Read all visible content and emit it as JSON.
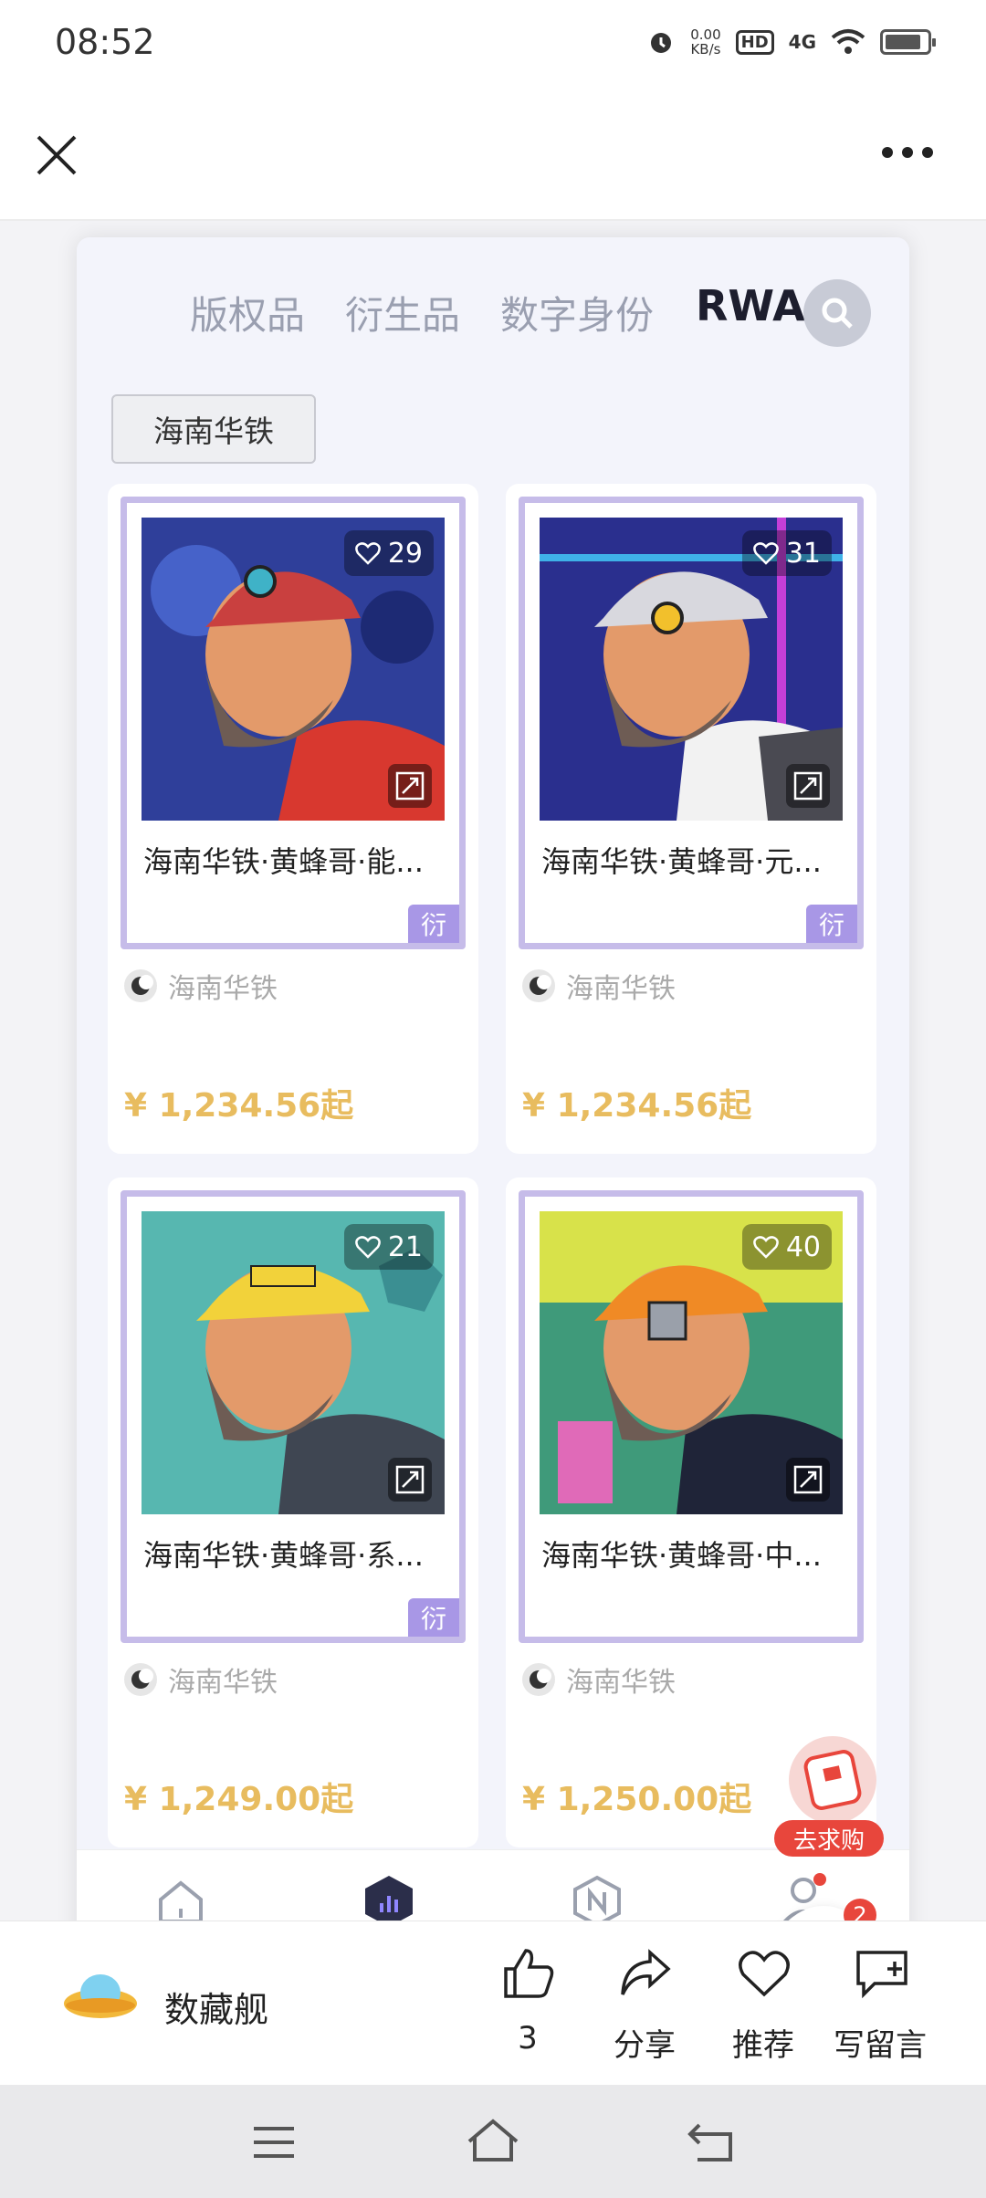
{
  "status_bar": {
    "time": "08:52",
    "net_speed_value": "0.00",
    "net_speed_unit": "KB/s",
    "hd": "HD",
    "network": "4G"
  },
  "top_nav": {
    "close_icon": "close-icon",
    "more_icon": "more-icon"
  },
  "tabs": [
    {
      "label": "版权品",
      "active": false
    },
    {
      "label": "衍生品",
      "active": false
    },
    {
      "label": "数字身份",
      "active": false
    },
    {
      "label": "RWA",
      "active": true
    }
  ],
  "filter_chip": "海南华铁",
  "cards": [
    {
      "likes": "29",
      "title": "海南华铁·黄蜂哥·能...",
      "tag": "衍",
      "brand": "海南华铁",
      "price": "¥ 1,234.56起",
      "helmet": "#c9403f",
      "bg": "#2f3f9a",
      "shirt": "#d8382f"
    },
    {
      "likes": "31",
      "title": "海南华铁·黄蜂哥·元...",
      "tag": "衍",
      "brand": "海南华铁",
      "price": "¥ 1,234.56起",
      "helmet": "#d8d8de",
      "bg": "#2a2f8e",
      "shirt": "#f2f2f2"
    },
    {
      "likes": "21",
      "title": "海南华铁·黄蜂哥·系...",
      "tag": "衍",
      "brand": "海南华铁",
      "price": "¥ 1,249.00起",
      "helmet": "#f2d23a",
      "bg": "#57b7b0",
      "shirt": "#3f4652"
    },
    {
      "likes": "40",
      "title": "海南华铁·黄蜂哥·中...",
      "tag": "",
      "brand": "海南华铁",
      "price": "¥ 1,250.00起",
      "helmet": "#f08a25",
      "bg": "#3f9a7a",
      "shirt": "#1f2438"
    }
  ],
  "floating": {
    "qiugou_label": "去求购",
    "cart_count": "2"
  },
  "wechat_bar": {
    "app_name": "数藏舰",
    "likes_count": "3",
    "share": "分享",
    "recommend": "推荐",
    "comment": "写留言"
  }
}
